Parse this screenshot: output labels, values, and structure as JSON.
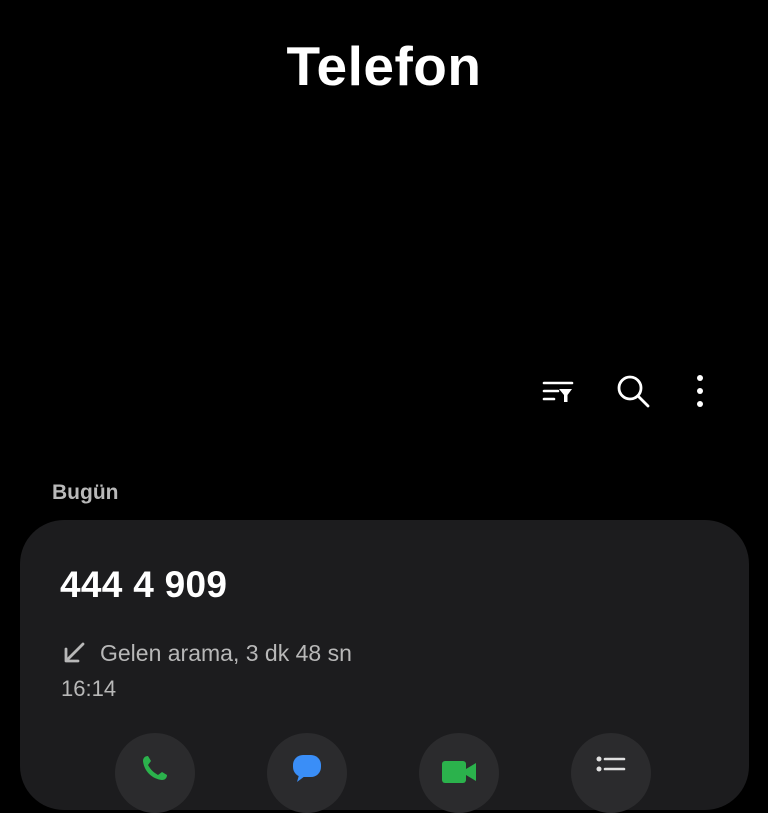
{
  "app": {
    "title": "Telefon"
  },
  "toolbar": {
    "filter_icon": "filter-sort-icon",
    "search_icon": "search-icon",
    "more_icon": "more-vertical-icon"
  },
  "call_log": {
    "section_label": "Bugün",
    "entries": [
      {
        "number": "444 4 909",
        "direction_icon": "incoming-call-arrow-icon",
        "detail": "Gelen arama, 3 dk 48 sn",
        "time": "16:14",
        "actions": [
          {
            "name": "call",
            "icon": "phone-icon",
            "color": "#2bb24c"
          },
          {
            "name": "message",
            "icon": "message-icon",
            "color": "#3a8ef7"
          },
          {
            "name": "video-call",
            "icon": "video-call-icon",
            "color": "#2bb24c"
          },
          {
            "name": "details",
            "icon": "details-list-icon",
            "color": "#e0e0e0"
          }
        ]
      }
    ]
  },
  "colors": {
    "background": "#000000",
    "card": "#1c1c1e",
    "secondary_text": "#b8b8b8",
    "call_green": "#2bb24c",
    "message_blue": "#3a8ef7"
  }
}
